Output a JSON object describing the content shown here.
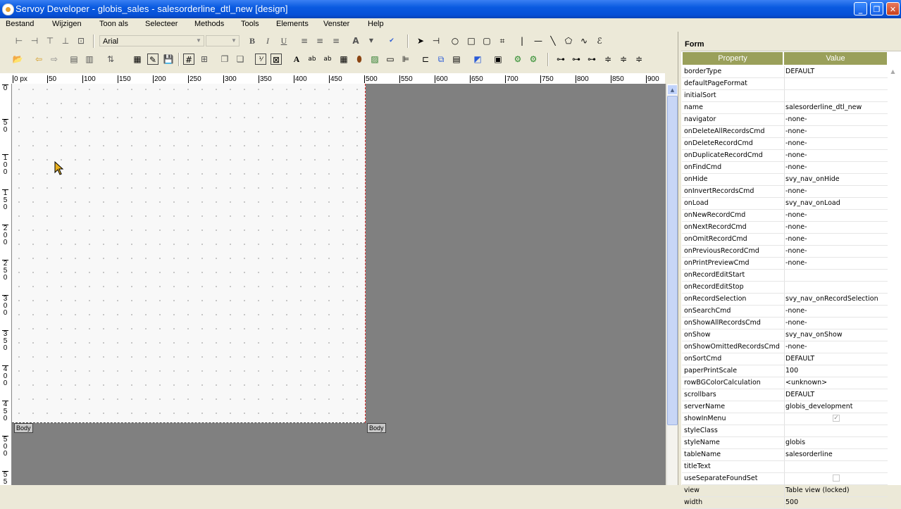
{
  "window": {
    "title": "Servoy Developer - globis_sales - salesorderline_dtl_new [design]",
    "controls": [
      "_",
      "❐",
      "✕"
    ]
  },
  "menu": [
    "Bestand",
    "Wijzigen",
    "Toon als",
    "Selecteer",
    "Methods",
    "Tools",
    "Elements",
    "Venster",
    "Help"
  ],
  "toolbar": {
    "font_name": "Arial",
    "font_size": "",
    "bold": "B",
    "italic": "I",
    "underline": "U"
  },
  "ruler": {
    "h_labels": [
      "0 px",
      "50",
      "100",
      "150",
      "200",
      "250",
      "300",
      "350",
      "400",
      "450",
      "500",
      "550",
      "600",
      "650",
      "700",
      "750",
      "800",
      "850",
      "900"
    ],
    "v_labels": [
      "0",
      "5 0",
      "1 0 0",
      "1 5 0",
      "2 0 0",
      "2 5 0",
      "3 0 0",
      "3 5 0",
      "4 0 0",
      "4 5 0",
      "5 0 0",
      "5 5"
    ]
  },
  "canvas": {
    "part_label_left": "Body",
    "part_label_right": "Body"
  },
  "panel": {
    "title": "Form",
    "col_property": "Property",
    "col_value": "Value",
    "rows": [
      {
        "name": "borderType",
        "value": "DEFAULT"
      },
      {
        "name": "defaultPageFormat",
        "value": ""
      },
      {
        "name": "initialSort",
        "value": ""
      },
      {
        "name": "name",
        "value": "salesorderline_dtl_new"
      },
      {
        "name": "navigator",
        "value": "-none-"
      },
      {
        "name": "onDeleteAllRecordsCmd",
        "value": "-none-"
      },
      {
        "name": "onDeleteRecordCmd",
        "value": "-none-"
      },
      {
        "name": "onDuplicateRecordCmd",
        "value": "-none-"
      },
      {
        "name": "onFindCmd",
        "value": "-none-"
      },
      {
        "name": "onHide",
        "value": "svy_nav_onHide"
      },
      {
        "name": "onInvertRecordsCmd",
        "value": "-none-"
      },
      {
        "name": "onLoad",
        "value": "svy_nav_onLoad"
      },
      {
        "name": "onNewRecordCmd",
        "value": "-none-"
      },
      {
        "name": "onNextRecordCmd",
        "value": "-none-"
      },
      {
        "name": "onOmitRecordCmd",
        "value": "-none-"
      },
      {
        "name": "onPreviousRecordCmd",
        "value": "-none-"
      },
      {
        "name": "onPrintPreviewCmd",
        "value": "-none-"
      },
      {
        "name": "onRecordEditStart",
        "value": ""
      },
      {
        "name": "onRecordEditStop",
        "value": ""
      },
      {
        "name": "onRecordSelection",
        "value": "svy_nav_onRecordSelection"
      },
      {
        "name": "onSearchCmd",
        "value": "-none-"
      },
      {
        "name": "onShowAllRecordsCmd",
        "value": "-none-"
      },
      {
        "name": "onShow",
        "value": "svy_nav_onShow"
      },
      {
        "name": "onShowOmittedRecordsCmd",
        "value": "-none-"
      },
      {
        "name": "onSortCmd",
        "value": "DEFAULT"
      },
      {
        "name": "paperPrintScale",
        "value": "100"
      },
      {
        "name": "rowBGColorCalculation",
        "value": "<unknown>"
      },
      {
        "name": "scrollbars",
        "value": "DEFAULT"
      },
      {
        "name": "serverName",
        "value": "globis_development"
      },
      {
        "name": "showInMenu",
        "value": "",
        "checkbox": true,
        "checked": true
      },
      {
        "name": "styleClass",
        "value": ""
      },
      {
        "name": "styleName",
        "value": "globis"
      },
      {
        "name": "tableName",
        "value": "salesorderline"
      },
      {
        "name": "titleText",
        "value": ""
      },
      {
        "name": "useSeparateFoundSet",
        "value": "",
        "checkbox": true,
        "checked": false
      },
      {
        "name": "view",
        "value": "Table view (locked)"
      },
      {
        "name": "width",
        "value": "500"
      }
    ]
  }
}
